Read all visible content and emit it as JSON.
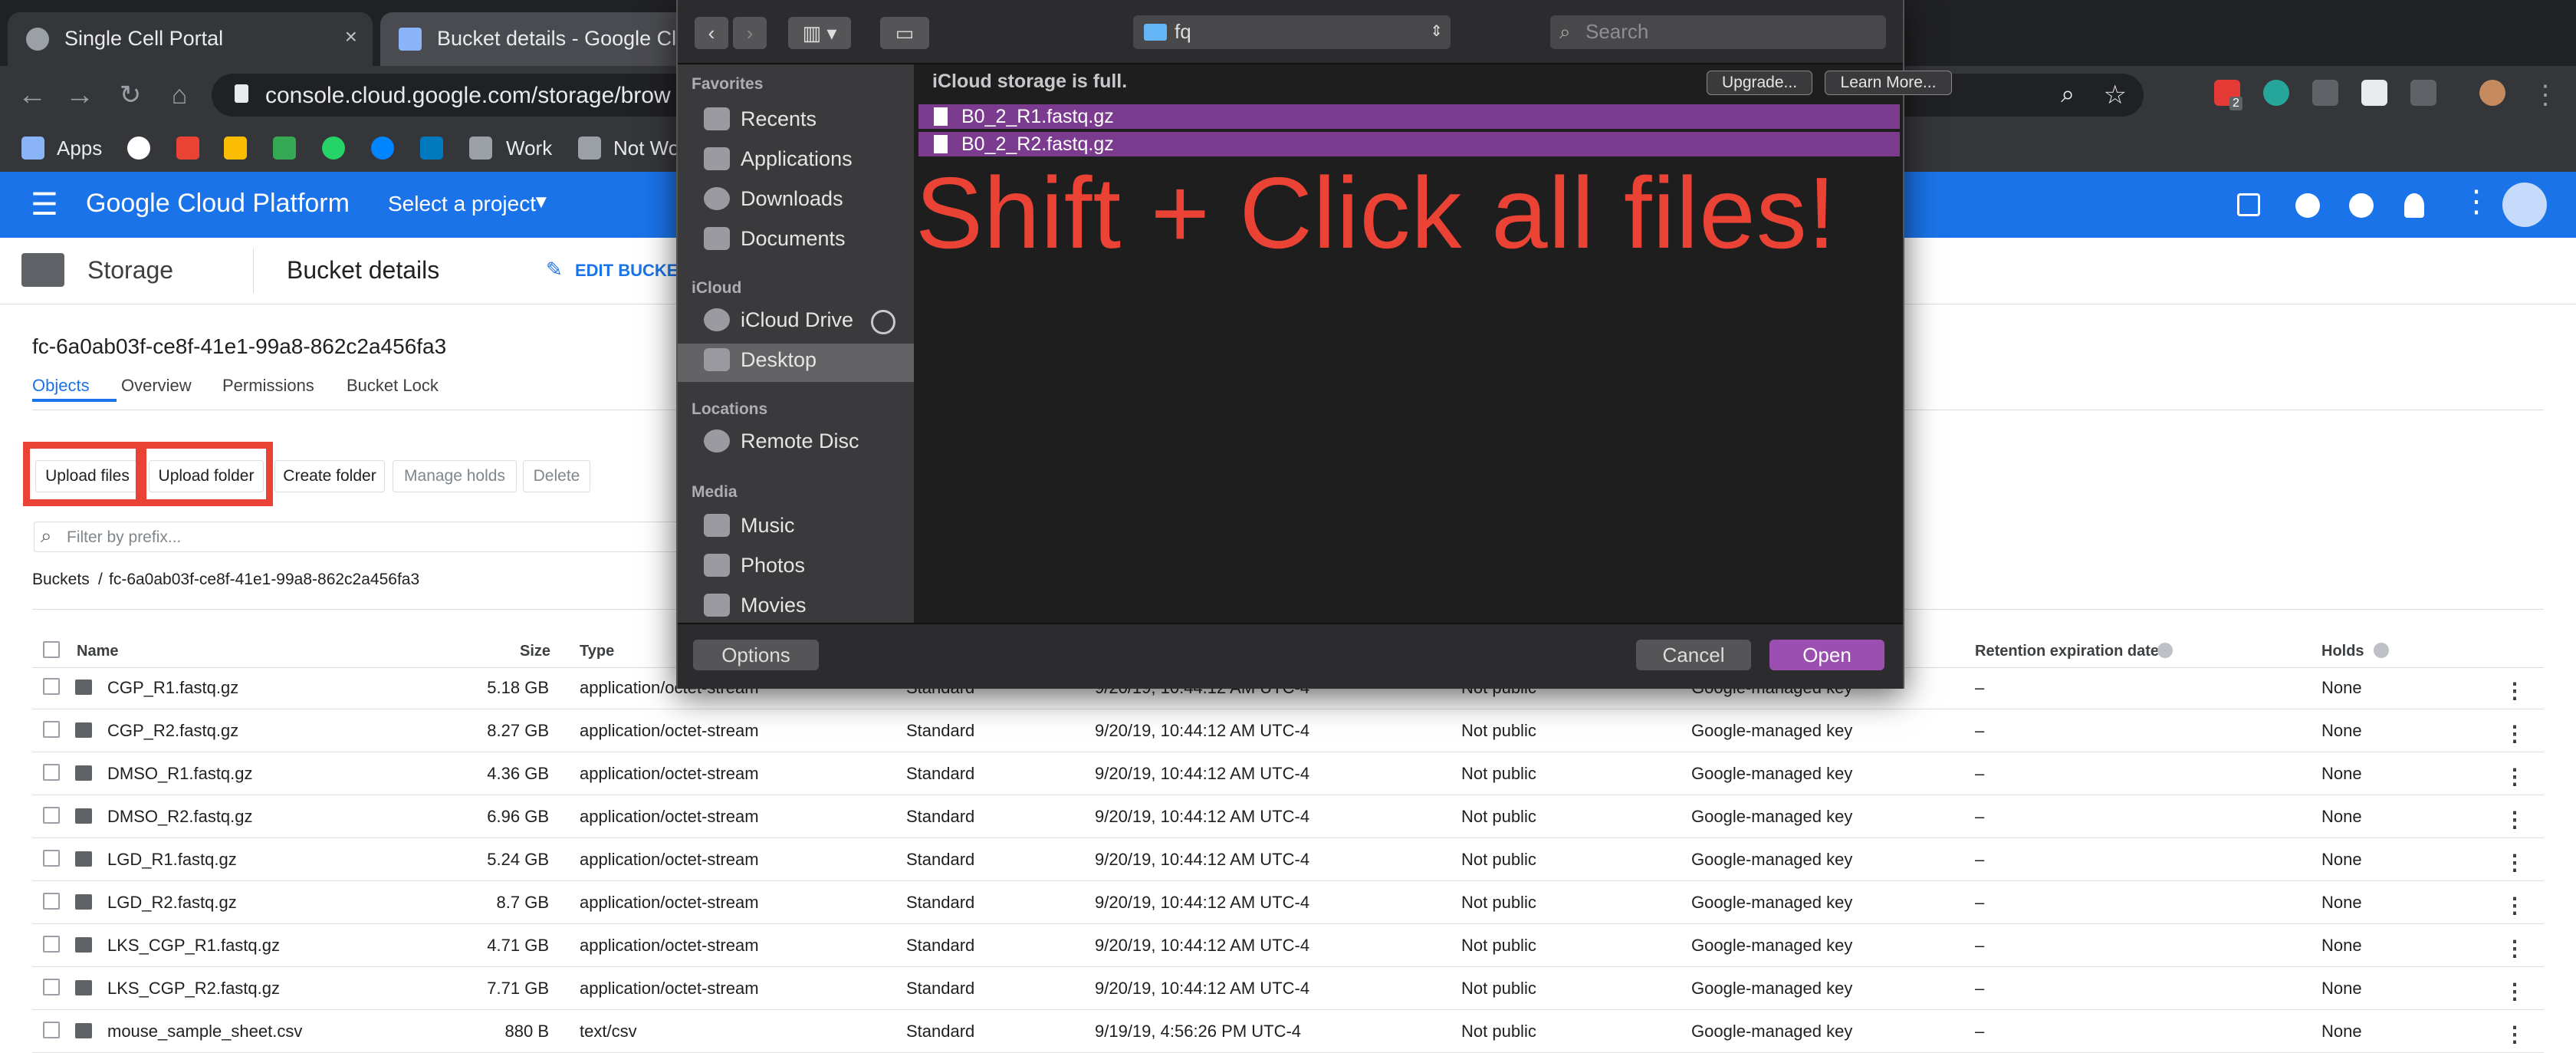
{
  "browser": {
    "tabs": [
      {
        "title": "Single Cell Portal",
        "close": "×"
      },
      {
        "title": "Bucket details - Google Clou"
      }
    ],
    "url": "console.cloud.google.com/storage/brow",
    "ext_badge": "2",
    "bookmarks": [
      "Apps",
      "Work",
      "Not Wo"
    ]
  },
  "gcp": {
    "brand": "Google Cloud Platform",
    "project": "Select a project",
    "section": "Storage",
    "page": "Bucket details",
    "edit": "EDIT BUCKET",
    "bucket": "fc-6a0ab03f-ce8f-41e1-99a8-862c2a456fa3",
    "tabs": [
      "Objects",
      "Overview",
      "Permissions",
      "Bucket Lock"
    ],
    "actions": {
      "upload_files": "Upload files",
      "upload_folder": "Upload folder",
      "create_folder": "Create folder",
      "manage_holds": "Manage holds",
      "delete": "Delete"
    },
    "filter_placeholder": "Filter by prefix...",
    "breadcrumb": {
      "root": "Buckets",
      "sep": "/",
      "bucket": "fc-6a0ab03f-ce8f-41e1-99a8-862c2a456fa3"
    },
    "columns": {
      "name": "Name",
      "size": "Size",
      "type": "Type",
      "retention": "Retention expiration date",
      "holds": "Holds"
    },
    "rows": [
      {
        "name": "CGP_R1.fastq.gz",
        "size": "5.18 GB",
        "type": "application/octet-stream",
        "class": "Standard",
        "modified": "9/20/19, 10:44:12 AM UTC-4",
        "access": "Not public",
        "encryption": "Google-managed key",
        "retention": "–",
        "holds": "None"
      },
      {
        "name": "CGP_R2.fastq.gz",
        "size": "8.27 GB",
        "type": "application/octet-stream",
        "class": "Standard",
        "modified": "9/20/19, 10:44:12 AM UTC-4",
        "access": "Not public",
        "encryption": "Google-managed key",
        "retention": "–",
        "holds": "None"
      },
      {
        "name": "DMSO_R1.fastq.gz",
        "size": "4.36 GB",
        "type": "application/octet-stream",
        "class": "Standard",
        "modified": "9/20/19, 10:44:12 AM UTC-4",
        "access": "Not public",
        "encryption": "Google-managed key",
        "retention": "–",
        "holds": "None"
      },
      {
        "name": "DMSO_R2.fastq.gz",
        "size": "6.96 GB",
        "type": "application/octet-stream",
        "class": "Standard",
        "modified": "9/20/19, 10:44:12 AM UTC-4",
        "access": "Not public",
        "encryption": "Google-managed key",
        "retention": "–",
        "holds": "None"
      },
      {
        "name": "LGD_R1.fastq.gz",
        "size": "5.24 GB",
        "type": "application/octet-stream",
        "class": "Standard",
        "modified": "9/20/19, 10:44:12 AM UTC-4",
        "access": "Not public",
        "encryption": "Google-managed key",
        "retention": "–",
        "holds": "None"
      },
      {
        "name": "LGD_R2.fastq.gz",
        "size": "8.7 GB",
        "type": "application/octet-stream",
        "class": "Standard",
        "modified": "9/20/19, 10:44:12 AM UTC-4",
        "access": "Not public",
        "encryption": "Google-managed key",
        "retention": "–",
        "holds": "None"
      },
      {
        "name": "LKS_CGP_R1.fastq.gz",
        "size": "4.71 GB",
        "type": "application/octet-stream",
        "class": "Standard",
        "modified": "9/20/19, 10:44:12 AM UTC-4",
        "access": "Not public",
        "encryption": "Google-managed key",
        "retention": "–",
        "holds": "None"
      },
      {
        "name": "LKS_CGP_R2.fastq.gz",
        "size": "7.71 GB",
        "type": "application/octet-stream",
        "class": "Standard",
        "modified": "9/20/19, 10:44:12 AM UTC-4",
        "access": "Not public",
        "encryption": "Google-managed key",
        "retention": "–",
        "holds": "None"
      },
      {
        "name": "mouse_sample_sheet.csv",
        "size": "880 B",
        "type": "text/csv",
        "class": "Standard",
        "modified": "9/19/19, 4:56:26 PM UTC-4",
        "access": "Not public",
        "encryption": "Google-managed key",
        "retention": "–",
        "holds": "None"
      }
    ],
    "row_menu": "⋮"
  },
  "dialog": {
    "folder": "fq",
    "search_placeholder": "Search",
    "sidebar": {
      "favorites": "Favorites",
      "fav_items": [
        "Recents",
        "Applications",
        "Downloads",
        "Documents"
      ],
      "icloud": "iCloud",
      "icloud_items": [
        "iCloud Drive",
        "Desktop"
      ],
      "locations": "Locations",
      "location_items": [
        "Remote Disc"
      ],
      "media": "Media",
      "media_items": [
        "Music",
        "Photos",
        "Movies"
      ]
    },
    "storage_warning": "iCloud storage is full.",
    "upgrade": "Upgrade...",
    "learn_more": "Learn More...",
    "files": [
      "B0_2_R1.fastq.gz",
      "B0_2_R2.fastq.gz"
    ],
    "callout": "Shift + Click all files!",
    "options": "Options",
    "cancel": "Cancel",
    "open": "Open"
  },
  "colors": {
    "gcp_blue": "#1a73e8",
    "highlight": "#ea4335",
    "selection": "#7b3b8e",
    "open_button": "#9b4fb0"
  }
}
